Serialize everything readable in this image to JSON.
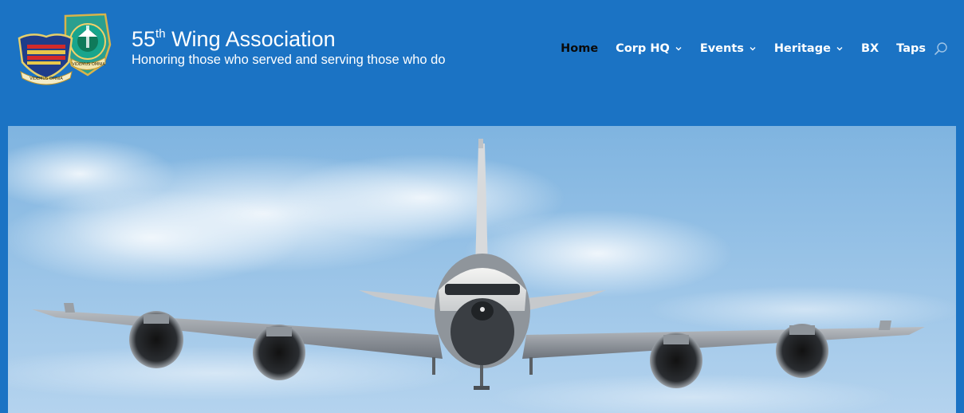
{
  "site": {
    "title_main": "55",
    "title_sup": "th",
    "title_rest": " Wing Association",
    "tagline": "Honoring those who served and serving those who do"
  },
  "logos": {
    "left_motto": "VIDEMUS OMNIA",
    "right_motto": "VIDEMUS OMNIA"
  },
  "nav": {
    "items": [
      {
        "label": "Home",
        "active": true,
        "dropdown": false
      },
      {
        "label": "Corp HQ",
        "active": false,
        "dropdown": true
      },
      {
        "label": "Events",
        "active": false,
        "dropdown": true
      },
      {
        "label": "Heritage",
        "active": false,
        "dropdown": true
      },
      {
        "label": "BX",
        "active": false,
        "dropdown": false
      },
      {
        "label": "Taps",
        "active": false,
        "dropdown": false
      }
    ],
    "search_icon": "search-icon",
    "dropdown_icon": "chevron-down-icon"
  },
  "colors": {
    "header_bg": "#1b73c4",
    "text": "#ffffff",
    "active_text": "#0a0a0a",
    "sky": "#9cc7ea"
  },
  "hero": {
    "image": "aircraft-in-flight"
  }
}
